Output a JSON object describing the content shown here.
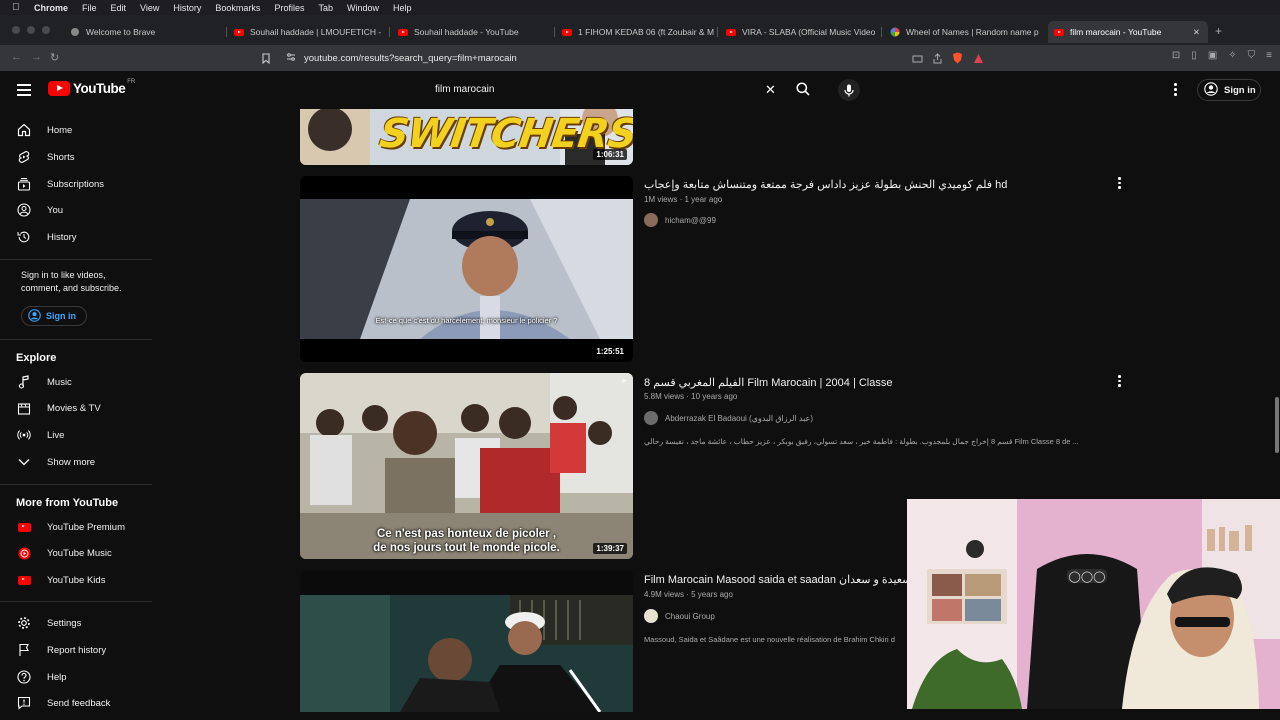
{
  "menubar": {
    "app": "Chrome",
    "items": [
      "File",
      "Edit",
      "View",
      "History",
      "Bookmarks",
      "Profiles",
      "Tab",
      "Window",
      "Help"
    ]
  },
  "tabs": [
    {
      "title": "Welcome to Brave",
      "icon": "brave-icon"
    },
    {
      "title": "Souhail haddade | LMOUFETICH -",
      "icon": "youtube-icon"
    },
    {
      "title": "Souhail haddade - YouTube",
      "icon": "youtube-icon"
    },
    {
      "title": "1 FIHOM KEDAB 06 (ft Zoubair & M",
      "icon": "youtube-icon"
    },
    {
      "title": "VIRA - SLABA (Official Music Video",
      "icon": "youtube-icon"
    },
    {
      "title": "Wheel of Names | Random name p",
      "icon": "wheel-icon"
    },
    {
      "title": "film marocain - YouTube",
      "icon": "youtube-icon",
      "active": true
    }
  ],
  "omnibox": {
    "url": "youtube.com/results?search_query=film+marocain"
  },
  "header": {
    "logo_text": "YouTube",
    "country_code": "FR",
    "search_value": "film marocain",
    "signin_label": "Sign in"
  },
  "sidebar": {
    "main": [
      {
        "label": "Home",
        "icon": "home-icon"
      },
      {
        "label": "Shorts",
        "icon": "shorts-icon"
      },
      {
        "label": "Subscriptions",
        "icon": "subscriptions-icon"
      },
      {
        "label": "You",
        "icon": "you-icon"
      },
      {
        "label": "History",
        "icon": "history-icon"
      }
    ],
    "signin_prompt": "Sign in to like videos, comment, and subscribe.",
    "signin_label": "Sign in",
    "explore_heading": "Explore",
    "explore": [
      {
        "label": "Music",
        "icon": "music-icon"
      },
      {
        "label": "Movies & TV",
        "icon": "movies-icon"
      },
      {
        "label": "Live",
        "icon": "live-icon"
      },
      {
        "label": "Show more",
        "icon": "chevron-down-icon"
      }
    ],
    "more_heading": "More from YouTube",
    "more": [
      {
        "label": "YouTube Premium",
        "icon": "youtube-premium-icon"
      },
      {
        "label": "YouTube Music",
        "icon": "youtube-music-icon"
      },
      {
        "label": "YouTube Kids",
        "icon": "youtube-kids-icon"
      }
    ],
    "footer": [
      {
        "label": "Settings",
        "icon": "settings-icon"
      },
      {
        "label": "Report history",
        "icon": "flag-icon"
      },
      {
        "label": "Help",
        "icon": "help-icon"
      },
      {
        "label": "Send feedback",
        "icon": "feedback-icon"
      }
    ]
  },
  "results": [
    {
      "thumb_text": "SWITCHERS",
      "duration": "1:06:31"
    },
    {
      "title": "فلم كوميدي الحنش بطولة عزيز داداس فرجة ممتعة ومتنساش متابعة وإعجاب hd",
      "views": "1M views",
      "age": "1 year ago",
      "channel": "hicham@@99",
      "duration": "1:25:51",
      "subtitle": "Est-ce que c'est du harcèlement, monsieur le policier ?"
    },
    {
      "title": "8 الفيلم المغربي قسم Film Marocain | 2004 | Classe",
      "views": "5.8M views",
      "age": "10 years ago",
      "channel": "Abderrazak El Badaoui (عبد الرزاق البدوي)",
      "description": "قسم 8 إخراج جمال بلمجدوب. بطولة : فاطمة خير ، سعد تسولي، رفيق بوبكر ، عزيز حطاب ، عائشة ماجد ، نفيسة رحالي Film Classe 8 de ...",
      "duration": "1:39:37",
      "subtitle_line1": "Ce n'est pas honteux de picoler ,",
      "subtitle_line2": "de nos jours tout le monde picole."
    },
    {
      "title": "Film Marocain Masood saida et saadan سعيدة و سعدان",
      "views": "4.9M views",
      "age": "5 years ago",
      "channel": "Chaoui Group",
      "description": "Massoud, Saida et Saâdane est une nouvelle réalisation de Brahim Chkiri d"
    }
  ],
  "colors": {
    "background": "#0f0f0f",
    "brand_red": "#ff0000",
    "link_blue": "#3ea6ff",
    "text": "#f1f1f1",
    "meta": "#aaaaaa"
  }
}
